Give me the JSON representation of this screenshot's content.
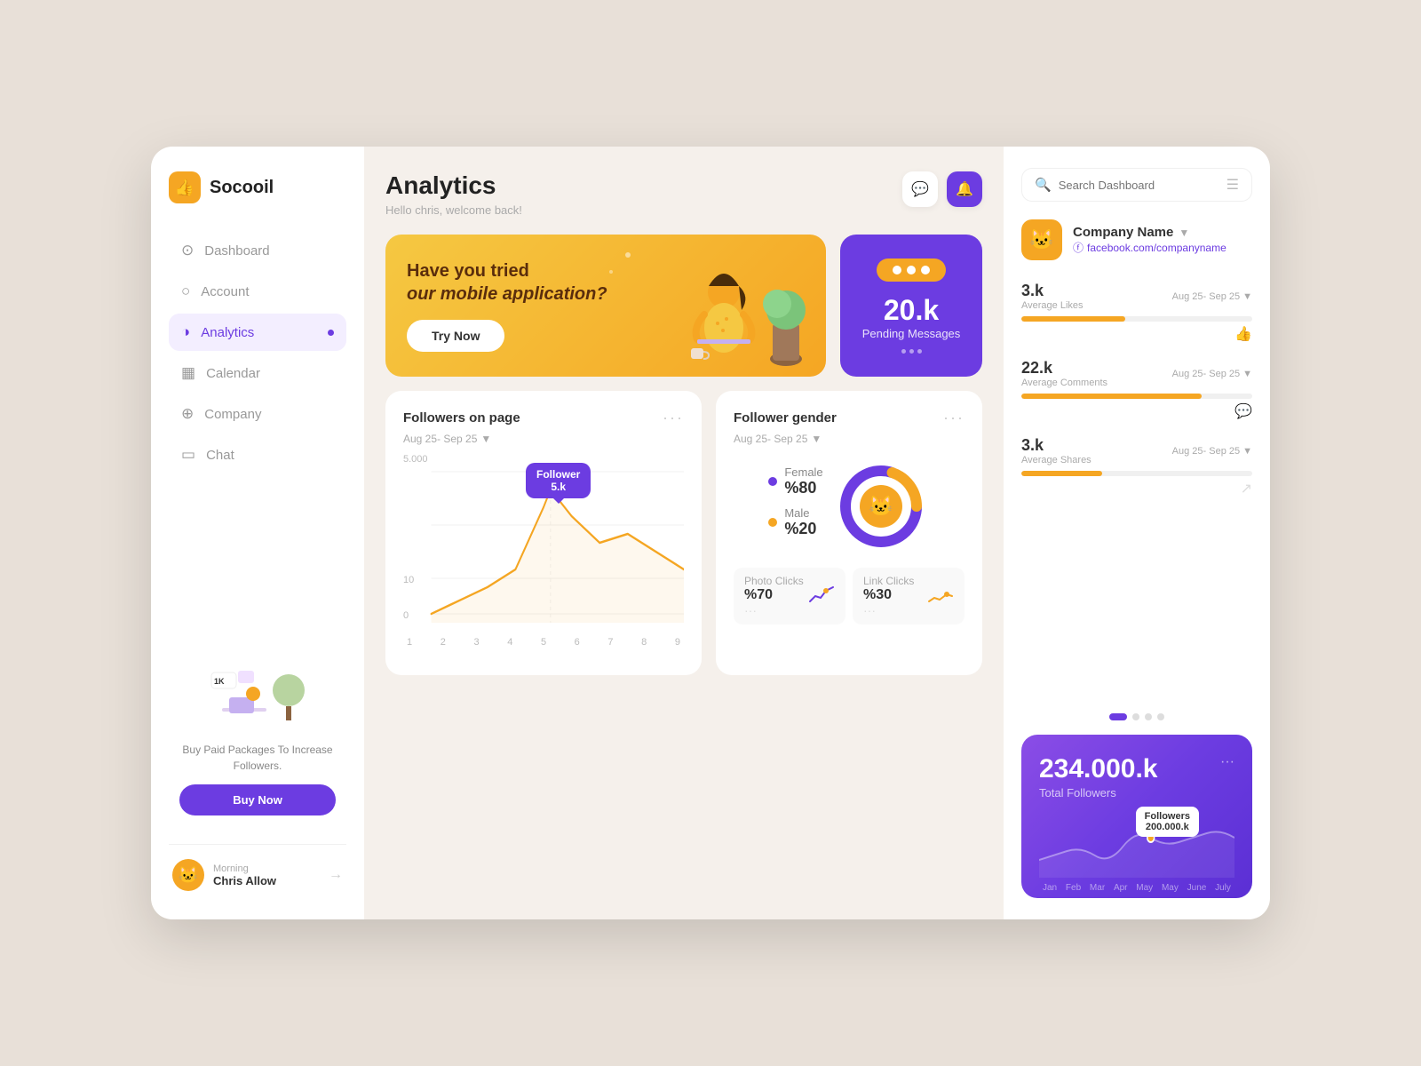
{
  "app": {
    "name": "Socooil"
  },
  "sidebar": {
    "nav_items": [
      {
        "label": "Dashboard",
        "icon": "⊙",
        "active": false
      },
      {
        "label": "Account",
        "icon": "○",
        "active": false
      },
      {
        "label": "Analytics",
        "icon": "◑",
        "active": true
      },
      {
        "label": "Calendar",
        "icon": "▦",
        "active": false
      },
      {
        "label": "Company",
        "icon": "⊕",
        "active": false
      },
      {
        "label": "Chat",
        "icon": "▭",
        "active": false
      }
    ],
    "promo": {
      "text": "Buy Paid Packages To Increase Followers.",
      "button_label": "Buy Now"
    },
    "user": {
      "greeting": "Morning",
      "name": "Chris Allow"
    }
  },
  "header": {
    "title": "Analytics",
    "subtitle": "Hello chris, welcome back!"
  },
  "promo_banner": {
    "text_line1": "Have you tried",
    "text_line2": "our mobile application?",
    "button_label": "Try Now",
    "pending": {
      "number": "20.k",
      "label": "Pending Messages"
    }
  },
  "followers_chart": {
    "title": "Followers on page",
    "date_range": "Aug 25- Sep 25",
    "tooltip_label": "Follower",
    "tooltip_value": "5.k",
    "y_labels": [
      "5.000",
      "10",
      "0"
    ],
    "x_labels": [
      "1",
      "2",
      "3",
      "4",
      "5",
      "6",
      "7",
      "8",
      "9"
    ]
  },
  "gender_card": {
    "title": "Follower gender",
    "date_range": "Aug 25- Sep 25",
    "female": {
      "label": "Female",
      "value": "%80"
    },
    "male": {
      "label": "Male",
      "value": "%20"
    },
    "photo_clicks": {
      "label": "Photo Clicks",
      "value": "%70"
    },
    "link_clicks": {
      "label": "Link Clicks",
      "value": "%30"
    }
  },
  "right_panel": {
    "search_placeholder": "Search Dashboard",
    "company": {
      "name": "Company Name",
      "url": "facebook.com/companyname"
    },
    "stats": [
      {
        "num": "3.k",
        "label": "Average Likes",
        "date": "Aug 25- Sep 25",
        "fill_pct": 45,
        "color": "#f5a623",
        "icon": "👍"
      },
      {
        "num": "22.k",
        "label": "Average Comments",
        "date": "Aug 25- Sep 25",
        "fill_pct": 78,
        "color": "#f5a623",
        "icon": "💬"
      },
      {
        "num": "3.k",
        "label": "Average Shares",
        "date": "Aug 25- Sep 25",
        "fill_pct": 35,
        "color": "#f5a623",
        "icon": "↗"
      }
    ],
    "total_followers": {
      "number": "234.000.k",
      "label": "Total Followers",
      "tooltip_label": "Followers",
      "tooltip_value": "200.000.k",
      "months": [
        "Jan",
        "Feb",
        "Mar",
        "Apr",
        "May",
        "May",
        "June",
        "July"
      ]
    }
  }
}
